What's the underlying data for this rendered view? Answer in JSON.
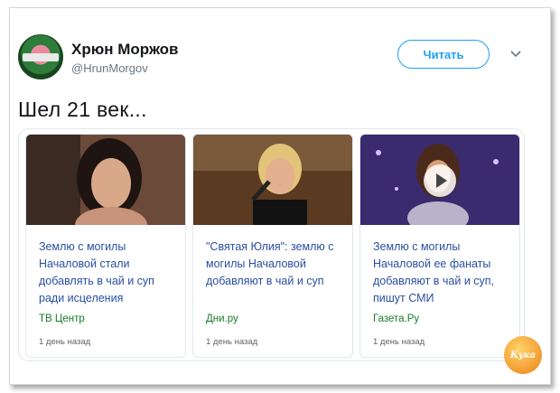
{
  "tweet": {
    "author_name": "Хрюн Моржов",
    "author_handle": "@HrunMorgov",
    "follow_label": "Читать",
    "text": "Шел 21 век..."
  },
  "cards": [
    {
      "headline": "Землю с могилы Началовой стали добавлять в чай и суп ради исцеления",
      "source": "ТВ Центр",
      "time": "1 день назад",
      "has_video": false
    },
    {
      "headline": "\"Святая Юлия\": землю с могилы Началовой добавляют в чай и суп",
      "source": "Дни.ру",
      "time": "1 день назад",
      "has_video": false
    },
    {
      "headline": "Землю с могилы Началовой ее фанаты добавляют в чай и суп, пишут СМИ",
      "source": "Газета.Ру",
      "time": "1 день назад",
      "has_video": true
    }
  ],
  "watermark": "Кука",
  "icons": {
    "caret": "chevron-down-icon",
    "play": "play-icon"
  },
  "colors": {
    "accent": "#1da1f2",
    "headline": "#2a4fa2",
    "source": "#1a7a2a"
  }
}
